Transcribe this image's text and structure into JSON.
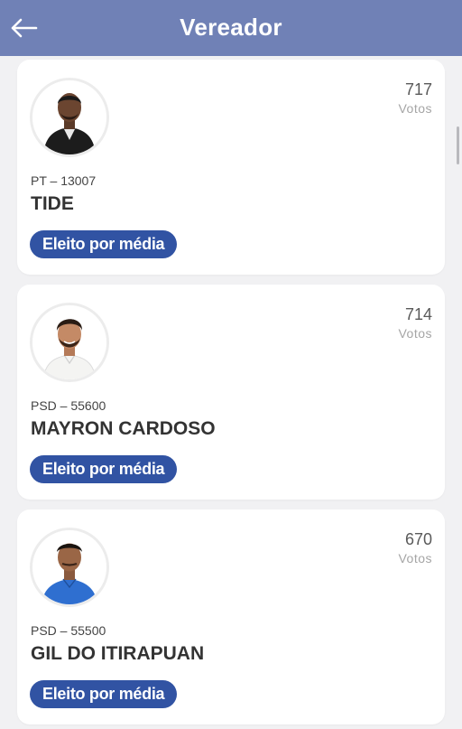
{
  "header": {
    "title": "Vereador",
    "back_icon": "arrow-left-icon"
  },
  "colors": {
    "header_bg": "#7081b6",
    "badge_bg": "#3153a3",
    "page_bg": "#f1f1f3"
  },
  "candidates": [
    {
      "votes": "717",
      "votes_label": "Votos",
      "party": "PT – 13007",
      "name": "TIDE",
      "status": "Eleito por média"
    },
    {
      "votes": "714",
      "votes_label": "Votos",
      "party": "PSD – 55600",
      "name": "MAYRON CARDOSO",
      "status": "Eleito por média"
    },
    {
      "votes": "670",
      "votes_label": "Votos",
      "party": "PSD – 55500",
      "name": "GIL DO ITIRAPUAN",
      "status": "Eleito por média"
    }
  ]
}
